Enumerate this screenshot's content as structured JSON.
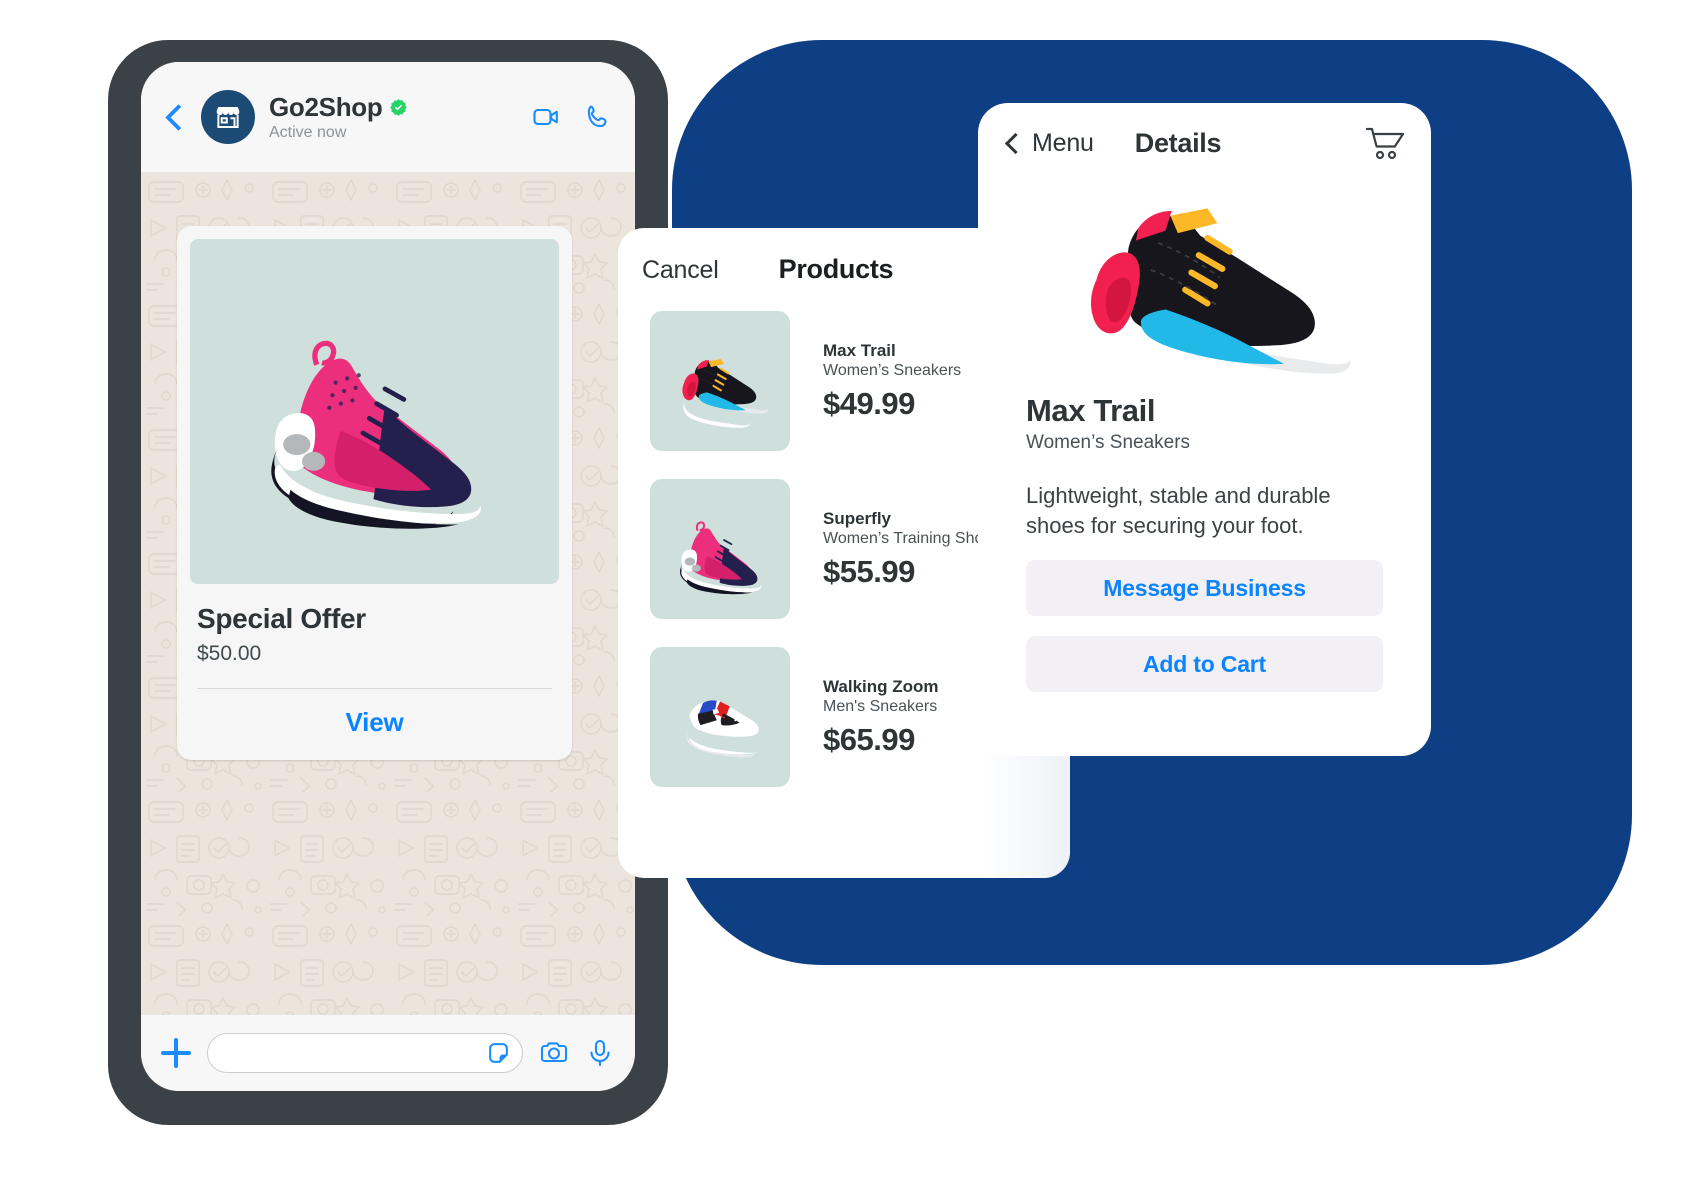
{
  "theme": {
    "blue_backdrop": "#0e3f85",
    "accent_blue": "#0a84ff",
    "whatsapp_blue": "#1a8cff",
    "verified_green": "#25d366",
    "chat_wallpaper": "#ece5dd",
    "thumb_bg": "#cfe0dc",
    "dark_text": "#2f3437"
  },
  "chat": {
    "header": {
      "back_icon": "chevron-left-icon",
      "avatar_icon": "storefront-icon",
      "contact_name": "Go2Shop",
      "verified_icon": "verified-badge-icon",
      "status": "Active now",
      "video_icon": "video-call-icon",
      "call_icon": "phone-call-icon"
    },
    "product_message": {
      "image_icon": "pink-navy-sneaker",
      "title": "Special Offer",
      "price": "$50.00",
      "action_label": "View"
    },
    "input_bar": {
      "plus_icon": "plus-icon",
      "input_value": "",
      "input_placeholder": "",
      "sticker_icon": "sticker-icon",
      "camera_icon": "camera-icon",
      "mic_icon": "microphone-icon"
    }
  },
  "products": {
    "cancel_label": "Cancel",
    "title": "Products",
    "items": [
      {
        "name": "Max Trail",
        "subtitle": "Women’s Sneakers",
        "price": "$49.99",
        "image_icon": "black-red-sneaker"
      },
      {
        "name": "Superfly",
        "subtitle": "Women’s Training Shoes",
        "price": "$55.99",
        "image_icon": "pink-navy-sneaker"
      },
      {
        "name": "Walking Zoom",
        "subtitle": "Men's Sneakers",
        "price": "$65.99",
        "image_icon": "white-blue-red-sneaker"
      }
    ]
  },
  "details": {
    "menu_label": "Menu",
    "back_icon": "chevron-left-icon",
    "title": "Details",
    "cart_icon": "shopping-cart-icon",
    "hero_icon": "black-red-sneaker",
    "product_name": "Max Trail",
    "product_subtitle": "Women’s Sneakers",
    "description": "Lightweight, stable and durable shoes for securing your foot.",
    "primary_button": "Message Business",
    "secondary_button": "Add to Cart"
  }
}
